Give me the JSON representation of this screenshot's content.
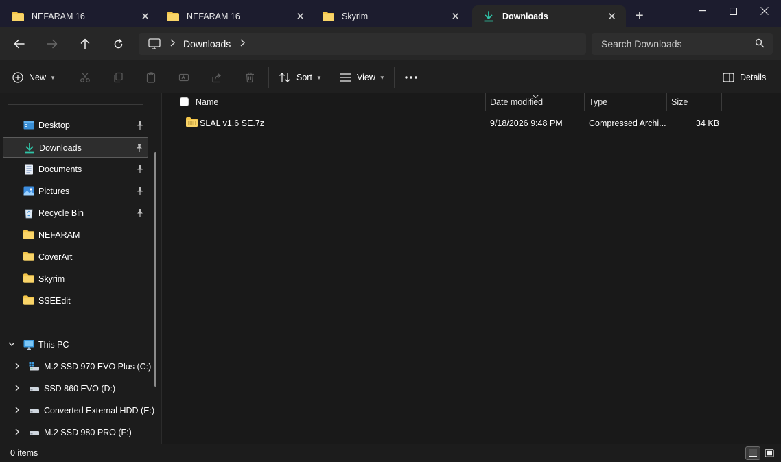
{
  "tabs": [
    {
      "label": "NEFARAM 16",
      "icon": "folder-icon",
      "active": false
    },
    {
      "label": "NEFARAM 16",
      "icon": "folder-icon",
      "active": false
    },
    {
      "label": "Skyrim",
      "icon": "folder-icon",
      "active": false
    },
    {
      "label": "Downloads",
      "icon": "download-icon",
      "active": true
    }
  ],
  "address": {
    "crumbs": [
      "Downloads"
    ]
  },
  "search": {
    "placeholder": "Search Downloads"
  },
  "commands": {
    "new_label": "New",
    "sort_label": "Sort",
    "view_label": "View",
    "details_label": "Details"
  },
  "sidebar": {
    "quick_access": [
      {
        "label": "Desktop",
        "icon": "desktop-icon",
        "pinned": true
      },
      {
        "label": "Downloads",
        "icon": "download-icon",
        "pinned": true,
        "selected": true
      },
      {
        "label": "Documents",
        "icon": "documents-icon",
        "pinned": true
      },
      {
        "label": "Pictures",
        "icon": "pictures-icon",
        "pinned": true
      },
      {
        "label": "Recycle Bin",
        "icon": "recycle-bin-icon",
        "pinned": true
      },
      {
        "label": "NEFARAM",
        "icon": "folder-icon",
        "pinned": false
      },
      {
        "label": "CoverArt",
        "icon": "folder-icon",
        "pinned": false
      },
      {
        "label": "Skyrim",
        "icon": "folder-icon",
        "pinned": false
      },
      {
        "label": "SSEEdit",
        "icon": "folder-icon",
        "pinned": false
      }
    ],
    "this_pc": {
      "label": "This PC",
      "expanded": true
    },
    "drives": [
      {
        "label": "M.2 SSD 970 EVO Plus (C:)",
        "icon": "system-drive-icon"
      },
      {
        "label": "SSD 860 EVO (D:)",
        "icon": "drive-icon"
      },
      {
        "label": "Converted External HDD (E:)",
        "icon": "drive-icon"
      },
      {
        "label": "M.2 SSD 980 PRO (F:)",
        "icon": "drive-icon"
      }
    ]
  },
  "columns": {
    "name": "Name",
    "date": "Date modified",
    "type": "Type",
    "size": "Size"
  },
  "files": [
    {
      "name": "SLAL v1.6 SE.7z",
      "date": "9/18/2026 9:48 PM",
      "type": "Compressed Archi...",
      "size": "34 KB",
      "icon": "archive-icon"
    }
  ],
  "status": {
    "count": "0 items"
  },
  "colors": {
    "accent": "#2fc3a7",
    "folder": "#f4c64a",
    "window_bg": "#191919",
    "titlebar_bg": "#1c1c2e"
  }
}
